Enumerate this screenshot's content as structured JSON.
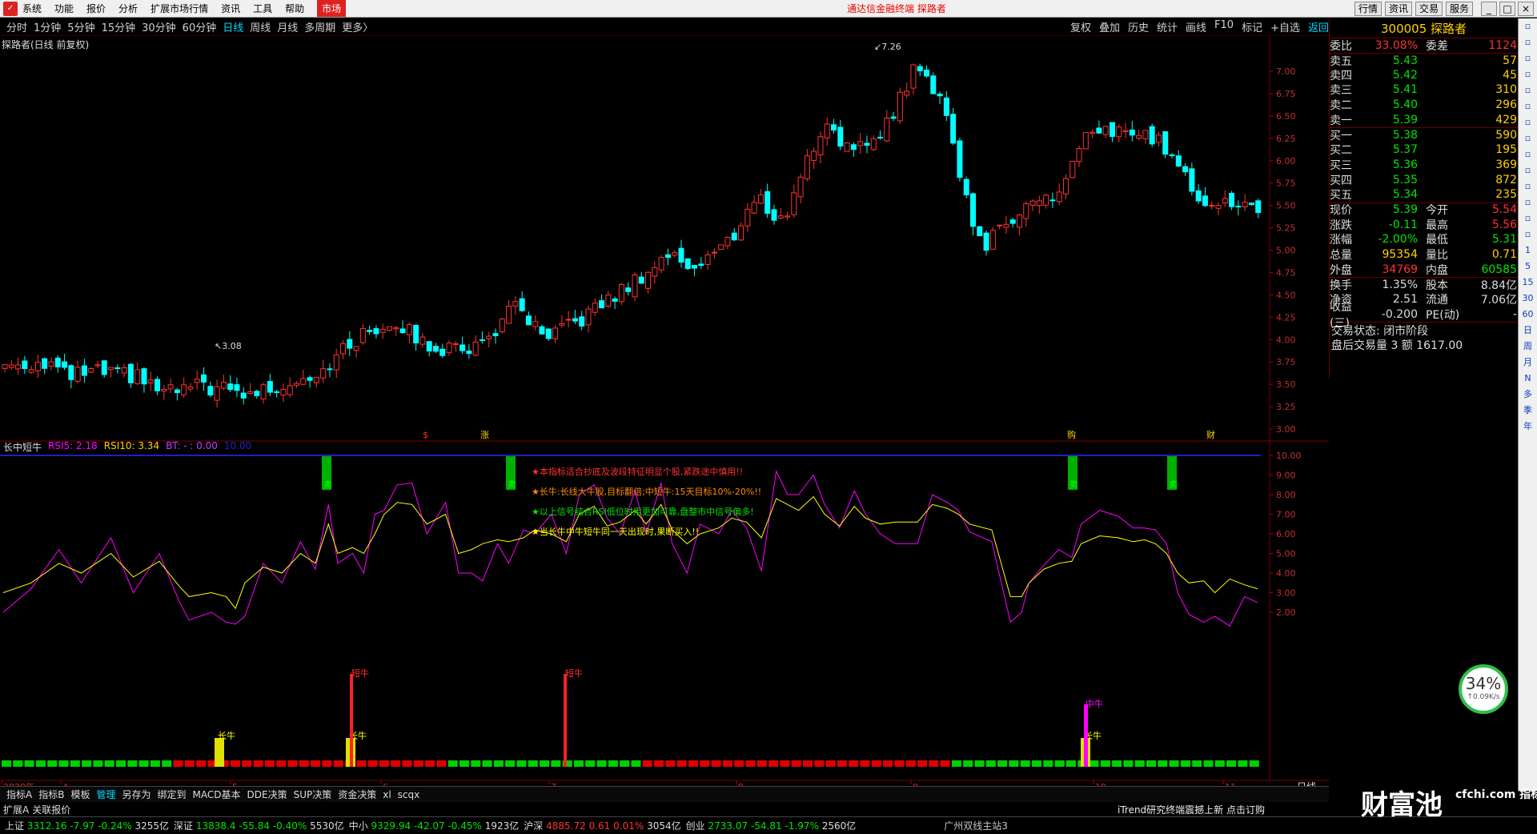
{
  "titlebar": {
    "menu": [
      "系统",
      "功能",
      "报价",
      "分析",
      "扩展市场行情",
      "资讯",
      "工具",
      "帮助"
    ],
    "active": "市场",
    "center": "通达信金融终端  探路者",
    "right_buttons": [
      "行情",
      "资讯",
      "交易",
      "服务"
    ]
  },
  "periods": {
    "items": [
      "分时",
      "1分钟",
      "5分钟",
      "15分钟",
      "30分钟",
      "60分钟",
      "日线",
      "周线",
      "月线",
      "多周期",
      "更多〉"
    ],
    "selected": "日线",
    "right": [
      "复权",
      "叠加",
      "历史",
      "统计",
      "画线",
      "F10",
      "标记",
      "+自选",
      "返回"
    ]
  },
  "stock_title": "探路者(日线 前复权)",
  "indicator": {
    "name": "长中短牛",
    "rsi5_label": "RSI5: 2.18",
    "rsi10_label": "RSI10: 3.34",
    "bt_label": "BT: - : 0.00",
    "val_label": "10.00",
    "notes": [
      "★本指标适合抄底及波段特征明显个股,紧跌途中慎用!!",
      "★长牛:长线大牛股,目标翻倍;中短牛:15天目标10%-20%!!",
      "★以上信号结合RSI低位时用更加可靠,盘整市中信号偏多!",
      "★当长牛中牛短牛同一天出现时,果断买入!!"
    ],
    "signal_long": "长牛",
    "signal_short": "短牛",
    "signal_mid": "中牛",
    "sell_label": "卖"
  },
  "price_axis": [
    "7.00",
    "6.75",
    "6.50",
    "6.25",
    "6.00",
    "5.75",
    "5.50",
    "5.25",
    "5.00",
    "4.75",
    "4.50",
    "4.25",
    "4.00",
    "3.75",
    "3.50",
    "3.25",
    "3.00"
  ],
  "ind_axis": [
    "10.00",
    "9.00",
    "8.00",
    "7.00",
    "6.00",
    "5.00",
    "4.00",
    "3.00",
    "2.00"
  ],
  "price_high": "7.26",
  "price_low": "3.08",
  "event_marks": [
    "$",
    "涨",
    "购",
    "财"
  ],
  "month_labels": [
    "2020年",
    "4",
    "5",
    "6",
    "7",
    "8",
    "9",
    "10",
    "11"
  ],
  "xaxis_right": "日线",
  "quote": {
    "code_name": "300005 探路者",
    "webi": {
      "label": "委比",
      "value": "33.08%",
      "label2": "委差",
      "value2": "1124"
    },
    "sells": [
      {
        "label": "卖五",
        "price": "5.43",
        "vol": "57"
      },
      {
        "label": "卖四",
        "price": "5.42",
        "vol": "45"
      },
      {
        "label": "卖三",
        "price": "5.41",
        "vol": "310"
      },
      {
        "label": "卖二",
        "price": "5.40",
        "vol": "296"
      },
      {
        "label": "卖一",
        "price": "5.39",
        "vol": "429"
      }
    ],
    "buys": [
      {
        "label": "买一",
        "price": "5.38",
        "vol": "590"
      },
      {
        "label": "买二",
        "price": "5.37",
        "vol": "195"
      },
      {
        "label": "买三",
        "price": "5.36",
        "vol": "369"
      },
      {
        "label": "买四",
        "price": "5.35",
        "vol": "872"
      },
      {
        "label": "买五",
        "price": "5.34",
        "vol": "235"
      }
    ],
    "stats": [
      {
        "l": "现价",
        "v": "5.39",
        "l2": "今开",
        "v2": "5.54"
      },
      {
        "l": "涨跌",
        "v": "-0.11",
        "l2": "最高",
        "v2": "5.56"
      },
      {
        "l": "涨幅",
        "v": "-2.00%",
        "l2": "最低",
        "v2": "5.31"
      },
      {
        "l": "总量",
        "v": "95354",
        "l2": "量比",
        "v2": "0.71"
      },
      {
        "l": "外盘",
        "v": "34769",
        "l2": "内盘",
        "v2": "60585"
      }
    ],
    "stats2": [
      {
        "l": "换手",
        "v": "1.35%",
        "l2": "股本",
        "v2": "8.84亿"
      },
      {
        "l": "净资",
        "v": "2.51",
        "l2": "流通",
        "v2": "7.06亿"
      },
      {
        "l": "收益(三)",
        "v": "-0.200",
        "l2": "PE(动)",
        "v2": "-"
      }
    ],
    "trade_state": "交易状态: 闭市阶段",
    "after_trade": "盘后交易量 3 额 1617.00"
  },
  "vtool": [
    "1",
    "5",
    "15",
    "30",
    "60",
    "日",
    "周",
    "月",
    "N",
    "多",
    "季",
    "年"
  ],
  "gauge": {
    "percent": "34%",
    "speed": "↑0.09K/s"
  },
  "tabs": {
    "items": [
      "指标A",
      "指标B",
      "模板",
      "管理",
      "另存为",
      "绑定到",
      "MACD基本",
      "DDE决策",
      "SUP决策",
      "资金决策",
      "xl",
      "scqx"
    ],
    "selected": "管理",
    "row2": [
      "扩展A",
      "关联报价"
    ],
    "announcement": "iTrend研究终端震撼上新 点击订购"
  },
  "status": [
    {
      "name": "上证",
      "v": "3312.16",
      "c": "-7.97",
      "p": "-0.24%",
      "a": "3255亿"
    },
    {
      "name": "深证",
      "v": "13838.4",
      "c": "-55.84",
      "p": "-0.40%",
      "a": "5530亿"
    },
    {
      "name": "中小",
      "v": "9329.94",
      "c": "-42.07",
      "p": "-0.45%",
      "a": "1923亿"
    },
    {
      "name": "沪深",
      "v": "4885.72",
      "c": "0.61",
      "p": "0.01%",
      "a": "3054亿"
    },
    {
      "name": "创业",
      "v": "2733.07",
      "c": "-54.81",
      "p": "-1.97%",
      "a": "2560亿"
    }
  ],
  "status_right": "广州双线主站3",
  "watermark": {
    "big": "财富池",
    "small": "cfchi.com 指标交易平台"
  },
  "colors": {
    "up": "#ff3232",
    "down": "#00ffff",
    "accent": "#00d7ff",
    "bg": "#000000"
  }
}
